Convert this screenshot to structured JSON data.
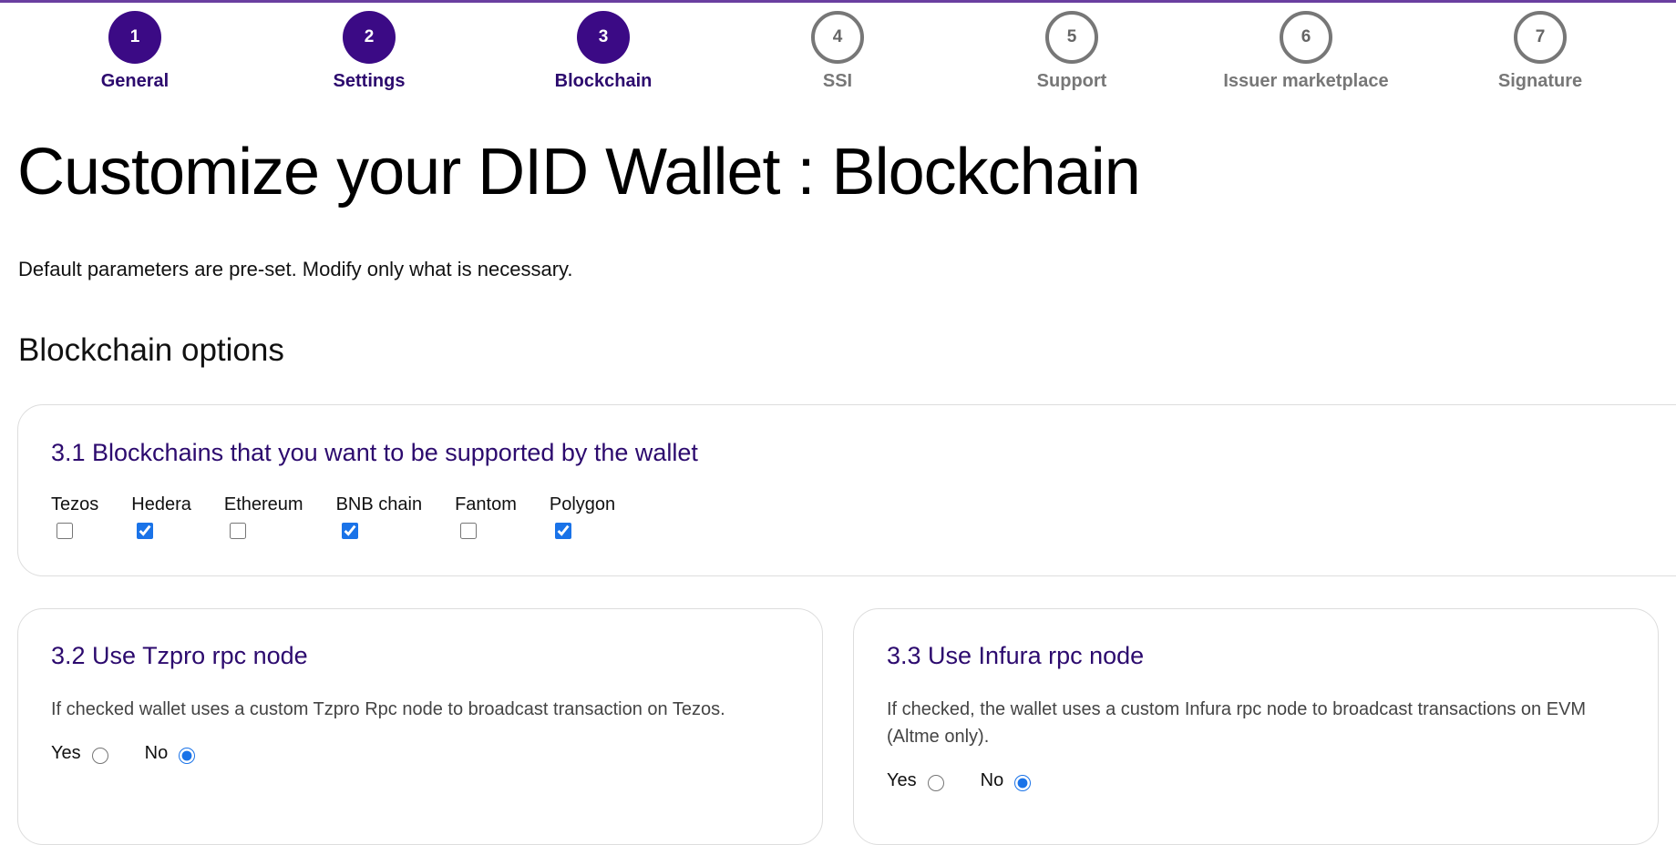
{
  "stepper": [
    {
      "number": "1",
      "label": "General",
      "state": "done"
    },
    {
      "number": "2",
      "label": "Settings",
      "state": "done"
    },
    {
      "number": "3",
      "label": "Blockchain",
      "state": "done"
    },
    {
      "number": "4",
      "label": "SSI",
      "state": "todo"
    },
    {
      "number": "5",
      "label": "Support",
      "state": "todo"
    },
    {
      "number": "6",
      "label": "Issuer marketplace",
      "state": "todo"
    },
    {
      "number": "7",
      "label": "Signature",
      "state": "todo"
    }
  ],
  "page": {
    "title": "Customize your DID Wallet : Blockchain",
    "intro": "Default parameters are pre-set. Modify only what is necessary.",
    "section_title": "Blockchain options"
  },
  "blockchains": {
    "title": "3.1 Blockchains that you want to be supported by the wallet",
    "items": [
      {
        "label": "Tezos",
        "checked": false
      },
      {
        "label": "Hedera",
        "checked": true
      },
      {
        "label": "Ethereum",
        "checked": false
      },
      {
        "label": "BNB chain",
        "checked": true
      },
      {
        "label": "Fantom",
        "checked": false
      },
      {
        "label": "Polygon",
        "checked": true
      }
    ]
  },
  "tzpro": {
    "title": "3.2 Use Tzpro rpc node",
    "description": "If checked wallet uses a custom Tzpro Rpc node to broadcast transaction on Tezos.",
    "yes_label": "Yes",
    "no_label": "No",
    "selected": "No"
  },
  "infura": {
    "title": "3.3 Use Infura rpc node",
    "description": "If checked, the wallet uses a custom Infura rpc node to broadcast transactions on EVM (Altme only).",
    "yes_label": "Yes",
    "no_label": "No",
    "selected": "No"
  },
  "colors": {
    "accent": "#3b0a85",
    "heading_purple": "#2c0a6e",
    "inactive": "#777777",
    "checkbox_blue": "#1a73e8"
  }
}
